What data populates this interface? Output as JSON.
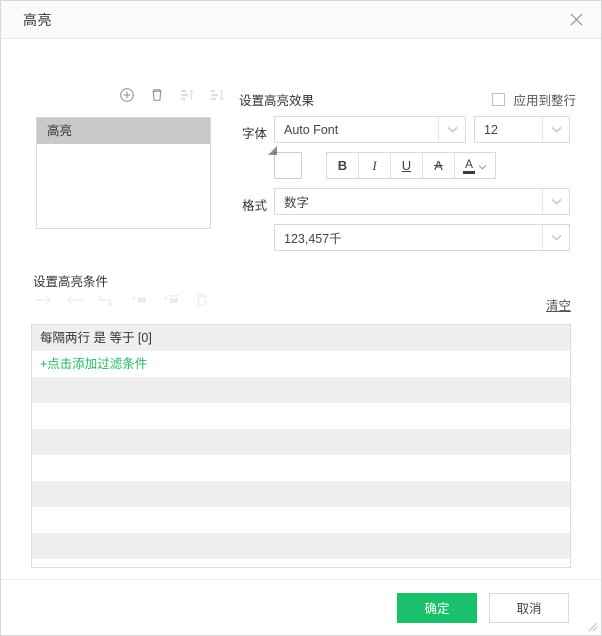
{
  "window": {
    "title": "高亮",
    "close_icon": "close-icon",
    "resize_grip": "resize-grip"
  },
  "rules_panel": {
    "toolbar": [
      {
        "name": "add-rule-button",
        "icon": "circle-plus-icon",
        "disabled": false
      },
      {
        "name": "delete-rule-button",
        "icon": "trash-icon",
        "disabled": false
      },
      {
        "name": "move-up-button",
        "icon": "sort-ascending-icon",
        "disabled": true
      },
      {
        "name": "move-down-button",
        "icon": "sort-descending-icon",
        "disabled": true
      }
    ],
    "items": [
      {
        "label": "高亮",
        "selected": true
      }
    ]
  },
  "effect_panel": {
    "section_title": "设置高亮效果",
    "apply_whole_row": {
      "label": "应用到整行",
      "checked": false
    },
    "font_label": "字体",
    "font_value": "Auto Font",
    "font_size_value": "12",
    "fill_color": "#FFD500",
    "format_buttons": [
      {
        "name": "bold-button",
        "label": "B"
      },
      {
        "name": "italic-button",
        "label": "I"
      },
      {
        "name": "underline-button",
        "label": "U"
      },
      {
        "name": "strikethrough-button",
        "label": "A"
      },
      {
        "name": "font-color-button",
        "label": "A"
      }
    ],
    "format_label": "格式",
    "format_value": "数字",
    "number_format_value": "123,457千"
  },
  "conditions_panel": {
    "section_title": "设置高亮条件",
    "toolbar": [
      {
        "name": "indent-right-button",
        "icon": "arrow-right-icon",
        "disabled": true
      },
      {
        "name": "indent-left-button",
        "icon": "arrow-left-icon",
        "disabled": true
      },
      {
        "name": "undo-button",
        "icon": "undo-arrow-icon",
        "disabled": true
      },
      {
        "name": "add-condition-button",
        "icon": "add-row-icon",
        "disabled": true
      },
      {
        "name": "add-group-button",
        "icon": "add-group-icon",
        "disabled": true
      },
      {
        "name": "delete-condition-button",
        "icon": "trash-icon",
        "disabled": true
      }
    ],
    "clear_label": "清空",
    "rows": [
      {
        "text": "每隔两行 是 等于 [0]",
        "type": "condition"
      },
      {
        "text": "+点击添加过滤条件",
        "type": "add"
      }
    ],
    "empty_row_count": 8
  },
  "filter_builder": {
    "field_value": "每隔两行",
    "operator1_value": "是",
    "operator2_value": "=",
    "value_value": "0",
    "more_button": "more-options-button"
  },
  "footer": {
    "ok_label": "确定",
    "cancel_label": "取消",
    "accent_color": "#1ac06b"
  }
}
